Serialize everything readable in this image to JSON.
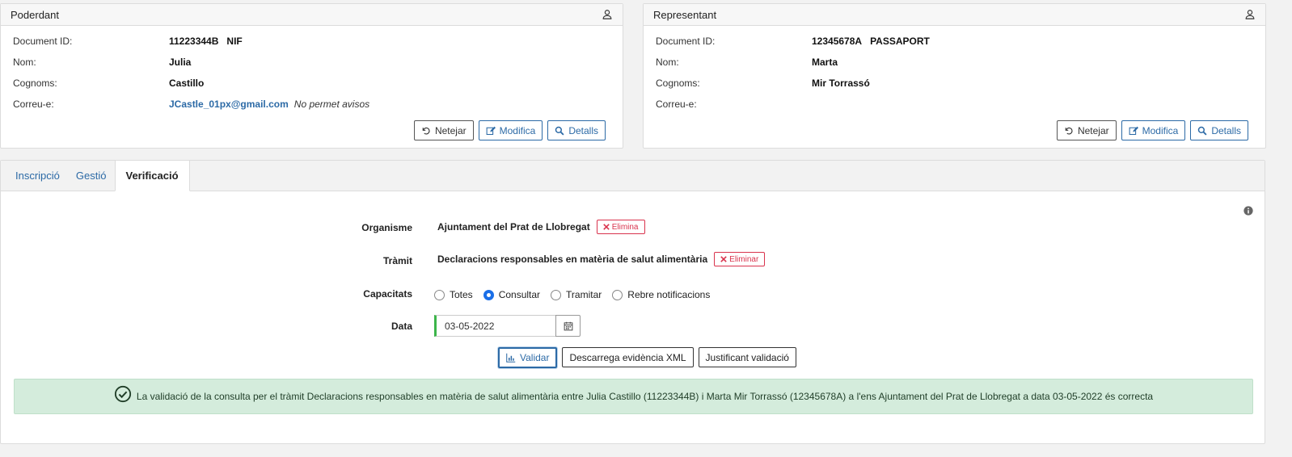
{
  "poderdant": {
    "title": "Poderdant",
    "rows": [
      {
        "label": "Document ID:",
        "value": "11223344B",
        "doctype": "NIF"
      },
      {
        "label": "Nom:",
        "value": "Julia"
      },
      {
        "label": "Cognoms:",
        "value": "Castillo"
      },
      {
        "label": "Correu-e:",
        "email": "JCastle_01px@gmail.com",
        "note": "No permet avisos"
      }
    ],
    "buttons": {
      "clear": "Netejar",
      "modify": "Modifica",
      "details": "Detalls"
    }
  },
  "representant": {
    "title": "Representant",
    "rows": [
      {
        "label": "Document ID:",
        "value": "12345678A",
        "doctype": "PASSAPORT"
      },
      {
        "label": "Nom:",
        "value": "Marta"
      },
      {
        "label": "Cognoms:",
        "value": "Mir Torrassó"
      },
      {
        "label": "Correu-e:",
        "value": ""
      }
    ],
    "buttons": {
      "clear": "Netejar",
      "modify": "Modifica",
      "details": "Detalls"
    }
  },
  "tabs": [
    {
      "label": "Inscripció",
      "active": false
    },
    {
      "label": "Gestió",
      "active": false
    },
    {
      "label": "Verificació",
      "active": true
    }
  ],
  "form": {
    "organisme": {
      "label": "Organisme",
      "value": "Ajuntament del Prat de Llobregat",
      "delete": "Elimina"
    },
    "tramit": {
      "label": "Tràmit",
      "value": "Declaracions responsables en matèria de salut alimentària",
      "delete": "Eliminar"
    },
    "capacitats": {
      "label": "Capacitats",
      "options": [
        "Totes",
        "Consultar",
        "Tramitar",
        "Rebre notificacions"
      ],
      "selected": "Consultar"
    },
    "data": {
      "label": "Data",
      "value": "03-05-2022"
    }
  },
  "actions": {
    "validate": "Validar",
    "download_xml": "Descarrega evidència XML",
    "receipt": "Justificant validació"
  },
  "alert": {
    "message": "La validació de la consulta per el tràmit Declaracions responsables en matèria de salut alimentària entre Julia Castillo (11223344B) i Marta Mir Torrassó (12345678A) a l'ens Ajuntament del Prat de Llobregat a data 03-05-2022 és correcta",
    "color": "#d4ecdc"
  },
  "colors": {
    "accent": "#2c6aa6",
    "danger": "#d9334d",
    "success": "#3cb54a"
  }
}
